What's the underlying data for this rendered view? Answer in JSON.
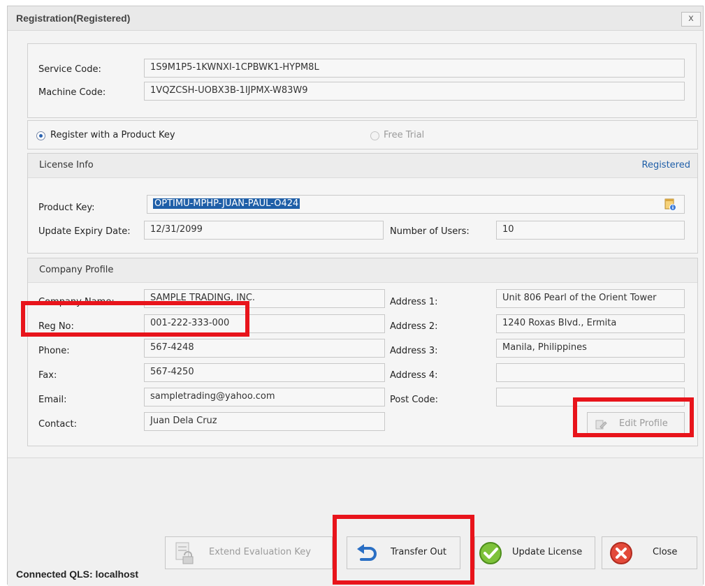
{
  "window": {
    "title": "Registration(Registered)",
    "close_glyph": "x"
  },
  "codes": {
    "service_code_label": "Service Code:",
    "service_code_value": "1S9M1P5-1KWNXI-1CPBWK1-HYPM8L",
    "machine_code_label": "Machine Code:",
    "machine_code_value": "1VQZCSH-UOBX3B-1IJPMX-W83W9"
  },
  "registration_mode": {
    "product_key_option": "Register with a Product Key",
    "free_trial_option": "Free Trial",
    "selected": "product_key"
  },
  "license_info": {
    "header": "License Info",
    "status": "Registered",
    "product_key_label": "Product Key:",
    "product_key_value": "OPTIMU-MPHP-JUAN-PAUL-O424",
    "update_expiry_label": "Update Expiry Date:",
    "update_expiry_value": "12/31/2099",
    "users_label": "Number of Users:",
    "users_value": "10"
  },
  "company_profile": {
    "header": "Company Profile",
    "company_name_label": "Company Name:",
    "company_name_value": "SAMPLE TRADING, INC.",
    "reg_no_label": "Reg No:",
    "reg_no_value": "001-222-333-000",
    "phone_label": "Phone:",
    "phone_value": "567-4248",
    "fax_label": "Fax:",
    "fax_value": "567-4250",
    "email_label": "Email:",
    "email_value": "sampletrading@yahoo.com",
    "contact_label": "Contact:",
    "contact_value": "Juan Dela Cruz",
    "address1_label": "Address 1:",
    "address1_value": "Unit 806 Pearl of the Orient Tower",
    "address2_label": "Address 2:",
    "address2_value": "1240 Roxas Blvd., Ermita",
    "address3_label": "Address 3:",
    "address3_value": "Manila, Philippines",
    "address4_label": "Address 4:",
    "address4_value": "",
    "postcode_label": "Post Code:",
    "postcode_value": "",
    "edit_profile_label": "Edit Profile"
  },
  "buttons": {
    "extend_evaluation": "Extend Evaluation Key",
    "transfer_out": "Transfer Out",
    "update_license": "Update License",
    "close": "Close"
  },
  "status_bar": {
    "connection": "Connected QLS: localhost"
  },
  "colors": {
    "highlight": "#e8141b",
    "accent": "#1e5ea8",
    "selection": "#1f5fa8"
  }
}
